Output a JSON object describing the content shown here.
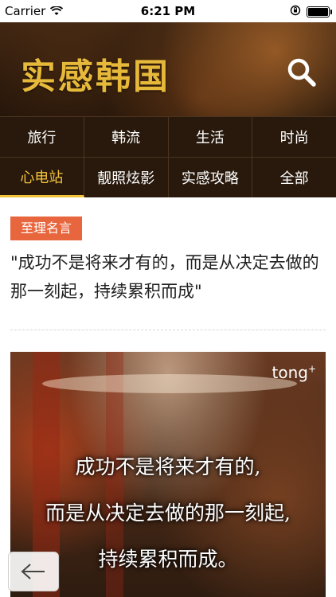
{
  "status_bar": {
    "carrier": "Carrier",
    "time": "6:21 PM",
    "icons": [
      "wifi-icon",
      "lock-rotation-icon",
      "battery-icon"
    ]
  },
  "header": {
    "title": "实感韩国",
    "title_color": "#e6b93a",
    "search_icon": "search-icon"
  },
  "nav": {
    "row1": [
      {
        "label": "旅行"
      },
      {
        "label": "韩流"
      },
      {
        "label": "生活"
      },
      {
        "label": "时尚"
      }
    ],
    "row2": [
      {
        "label": "心电站",
        "active": true
      },
      {
        "label": "靓照炫影"
      },
      {
        "label": "实感攻略"
      },
      {
        "label": "全部"
      }
    ],
    "active_color": "#f2c23b"
  },
  "article": {
    "tag": "至理名言",
    "tag_color": "#e8663e",
    "headline": "\"成功不是将来才有的，而是从决定去做的那一刻起，持续累积而成\"",
    "image": {
      "watermark": "tong",
      "watermark_sup": "+",
      "caption_lines": [
        "成功不是将来才有的,",
        "而是从决定去做的那一刻起,",
        "持续累积而成。"
      ]
    }
  },
  "back_button": {
    "icon": "arrow-left-icon"
  }
}
